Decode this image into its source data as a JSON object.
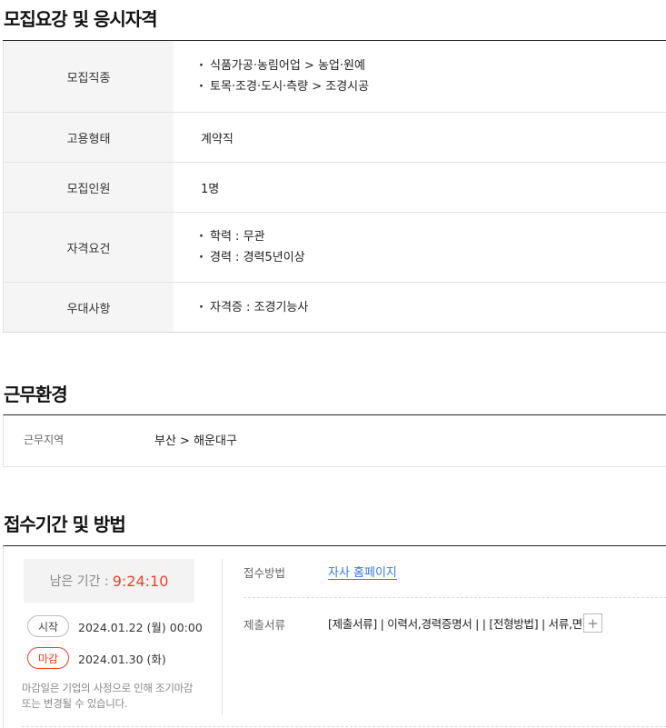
{
  "recruit": {
    "title": "모집요강 및 응시자격",
    "rows": [
      {
        "label": "모집직종",
        "items": [
          "식품가공·농림어업 > 농업·원예",
          "토목·조경·도시·측량 > 조경시공"
        ]
      },
      {
        "label": "고용형태",
        "value": "계약직"
      },
      {
        "label": "모집인원",
        "value": "1명"
      },
      {
        "label": "자격요건",
        "items": [
          "학력 : 무관",
          "경력 : 경력5년이상"
        ]
      },
      {
        "label": "우대사항",
        "items": [
          "자격증 : 조경기능사"
        ]
      }
    ]
  },
  "work": {
    "title": "근무환경",
    "location_label": "근무지역",
    "location_value": "부산 > 해운대구"
  },
  "apply": {
    "title": "접수기간 및 방법",
    "remain_label": "남은 기간 :",
    "remain_time": "9:24:10",
    "start_badge": "시작",
    "start_date": "2024.01.22 (월) 00:00",
    "end_badge": "마감",
    "end_date": "2024.01.30 (화)",
    "deadline_note": "마감일은 기업의 사정으로 인해 조기마감 또는 변경될 수 있습니다.",
    "method_label": "접수방법",
    "method_value": "자사 홈페이지",
    "docs_label": "제출서류",
    "docs_value": "[제출서류] | 이력서,경력증명서 | | [전형방법] | 서류,면접",
    "plus_label": "+"
  },
  "colors": {
    "accent_red": "#e8432e",
    "link_blue": "#3c78d8"
  }
}
